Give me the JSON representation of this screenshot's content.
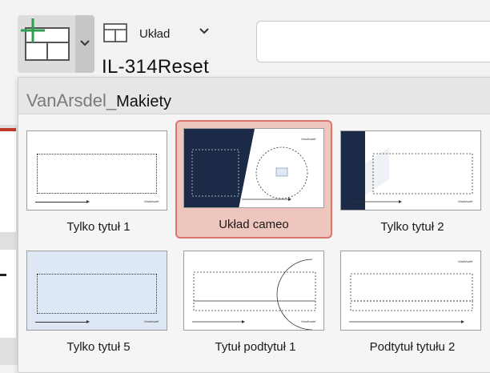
{
  "ribbon": {
    "layout_label": "Układ",
    "reset_label": "IL-314Reset"
  },
  "panel": {
    "brand": "VanArsdel_",
    "section": "Makiety"
  },
  "layouts": [
    {
      "label": "Tylko tytuł 1",
      "logo": "VanArsdel"
    },
    {
      "label": "Układ cameo",
      "logo": "VanArsdel",
      "selected": true
    },
    {
      "label": "Tylko tytuł 2",
      "logo": "VanArsdel"
    },
    {
      "label": "Tylko tytuł 5",
      "logo": "VanArsdel"
    },
    {
      "label": "Tytuł podtytuł 1",
      "logo": "VanArsdel"
    },
    {
      "label": "Podtytuł tytułu 2",
      "logo": "VanArsdel"
    }
  ],
  "colors": {
    "accent_navy": "#1b2a47",
    "selection_fill": "#efc6bd",
    "selection_border": "#d9756a",
    "new_slide_plus": "#2e9e4f"
  }
}
